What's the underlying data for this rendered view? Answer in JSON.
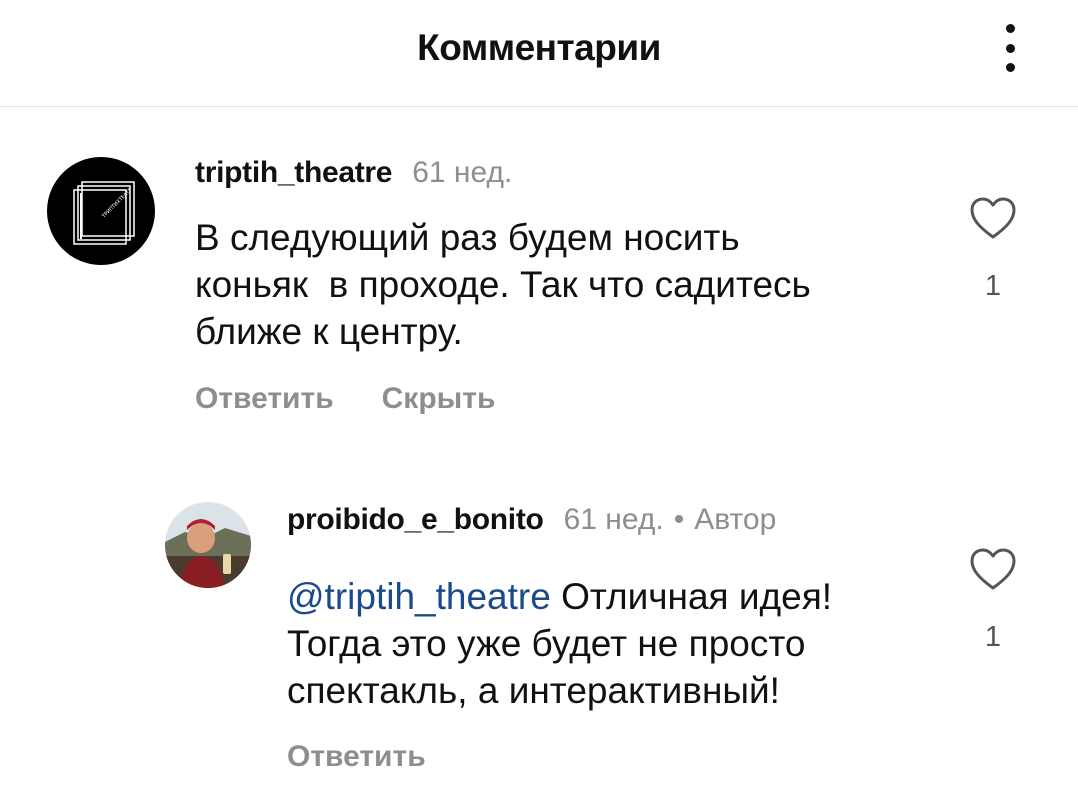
{
  "header": {
    "title": "Комментарии",
    "menu_icon": "more-vertical-icon"
  },
  "comments": [
    {
      "username": "triptih_theatre",
      "time": "61 нед.",
      "text_lines": [
        "В следующий раз будем носить",
        "коньяк  в проходе. Так что садитесь",
        "ближе к центру."
      ],
      "likes": "1",
      "actions": {
        "reply": "Ответить",
        "hide": "Скрыть"
      },
      "avatar_icon": "theatre-logo-icon",
      "avatar_logo_text": "ТРИПТИХТЕАТР"
    },
    {
      "username": "proibido_e_bonito",
      "time": "61 нед.",
      "dot": "•",
      "author_badge": "Автор",
      "mention": "@triptih_theatre",
      "text_lines": [
        " Отличная идея!",
        "Тогда это уже будет не просто",
        "спектакль, а интерактивный!"
      ],
      "likes": "1",
      "actions": {
        "reply": "Ответить"
      },
      "avatar_icon": "user-photo-icon"
    }
  ],
  "colors": {
    "muted": "#8e8e8e",
    "mention": "#1a4a8a",
    "divider": "#e6e6e6"
  }
}
